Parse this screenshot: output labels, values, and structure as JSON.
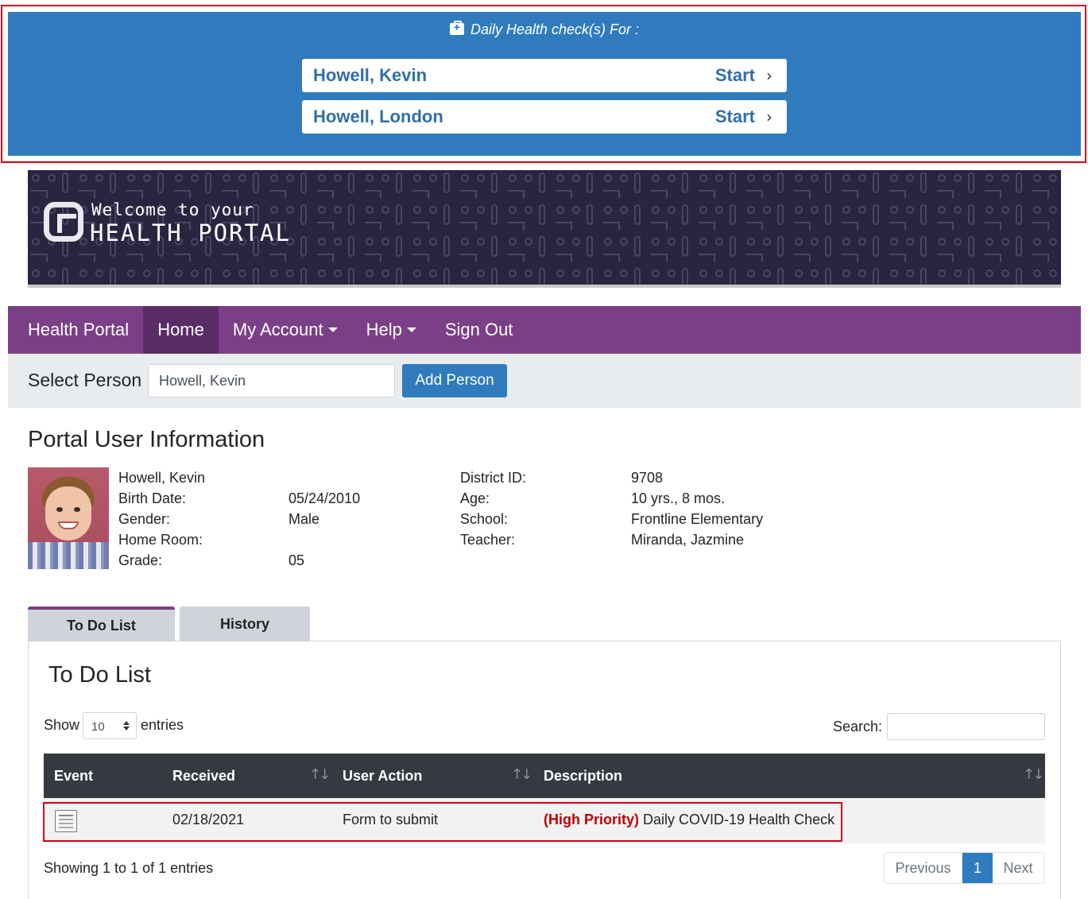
{
  "health_check": {
    "title": "Daily Health check(s) For :",
    "people": [
      {
        "name": "Howell, Kevin",
        "action": "Start"
      },
      {
        "name": "Howell, London",
        "action": "Start"
      }
    ]
  },
  "hero": {
    "line1": "Welcome to your",
    "line2": "HEALTH PORTAL"
  },
  "nav": {
    "brand": "Health Portal",
    "items": [
      "Home",
      "My Account",
      "Help",
      "Sign Out"
    ]
  },
  "select_person": {
    "label": "Select Person",
    "value": "Howell, Kevin",
    "add_button": "Add Person"
  },
  "user_info": {
    "title": "Portal User Information",
    "name": "Howell, Kevin",
    "labels_left": [
      "Birth Date:",
      "Gender:",
      "Home Room:",
      "Grade:"
    ],
    "values_left": [
      "05/24/2010",
      "Male",
      "",
      "05"
    ],
    "labels_right": [
      "District ID:",
      "Age:",
      "School:",
      "Teacher:"
    ],
    "values_right": [
      "9708",
      "10 yrs., 8 mos.",
      "Frontline Elementary",
      "Miranda, Jazmine"
    ]
  },
  "tabs": [
    "To Do List",
    "History"
  ],
  "todo": {
    "title": "To Do List",
    "show": "Show",
    "entries_value": "10",
    "entries": "entries",
    "search_label": "Search:",
    "columns": [
      "Event",
      "Received",
      "User Action",
      "Description"
    ],
    "rows": [
      {
        "event_icon": "form-icon",
        "received": "02/18/2021",
        "user_action": "Form to submit",
        "priority": "(High Priority)",
        "description": "Daily COVID-19 Health Check"
      }
    ],
    "showing": "Showing 1 to 1 of 1 entries",
    "pager": {
      "previous": "Previous",
      "page": "1",
      "next": "Next"
    }
  },
  "colors": {
    "banner_blue": "#2f7bbd",
    "nav_purple": "#7b3f87",
    "highlight_red": "#d0021b",
    "priority_red": "#c00000"
  }
}
